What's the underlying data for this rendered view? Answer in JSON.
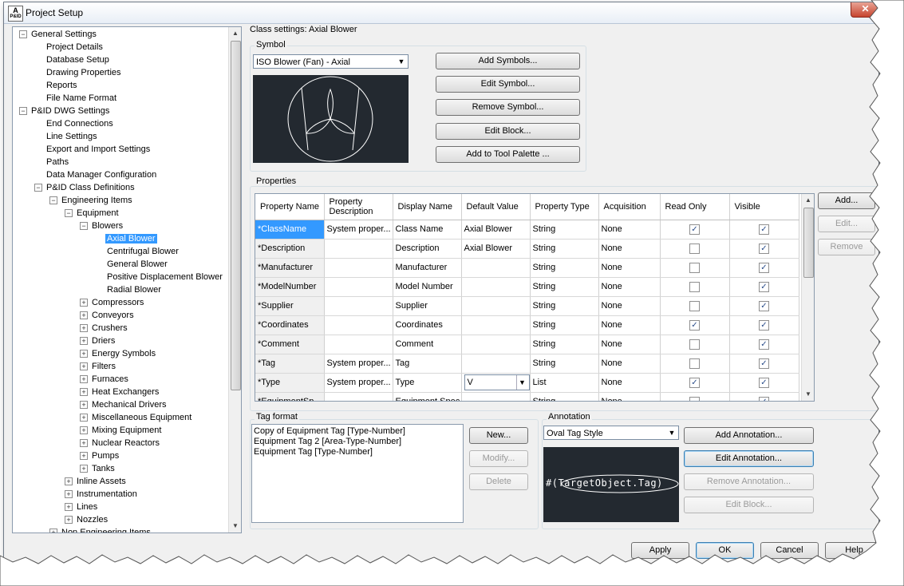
{
  "window": {
    "title": "Project Setup",
    "app_icon_text": "A",
    "app_icon_sub": "P&ID",
    "close_label": "✕"
  },
  "tree": {
    "nodes": [
      {
        "label": "General Settings",
        "level": 0,
        "expander": "−"
      },
      {
        "label": "Project Details",
        "level": 1
      },
      {
        "label": "Database Setup",
        "level": 1
      },
      {
        "label": "Drawing Properties",
        "level": 1
      },
      {
        "label": "Reports",
        "level": 1
      },
      {
        "label": "File Name Format",
        "level": 1
      },
      {
        "label": "P&ID DWG Settings",
        "level": 0,
        "expander": "−"
      },
      {
        "label": "End Connections",
        "level": 1
      },
      {
        "label": "Line Settings",
        "level": 1
      },
      {
        "label": "Export and Import Settings",
        "level": 1
      },
      {
        "label": "Paths",
        "level": 1
      },
      {
        "label": "Data Manager Configuration",
        "level": 1
      },
      {
        "label": "P&ID Class Definitions",
        "level": 1,
        "expander": "−"
      },
      {
        "label": "Engineering Items",
        "level": 2,
        "expander": "−"
      },
      {
        "label": "Equipment",
        "level": 3,
        "expander": "−"
      },
      {
        "label": "Blowers",
        "level": 4,
        "expander": "−"
      },
      {
        "label": "Axial Blower",
        "level": 5,
        "selected": true
      },
      {
        "label": "Centrifugal Blower",
        "level": 5
      },
      {
        "label": "General Blower",
        "level": 5
      },
      {
        "label": "Positive Displacement Blower",
        "level": 5
      },
      {
        "label": "Radial Blower",
        "level": 5
      },
      {
        "label": "Compressors",
        "level": 4,
        "expander": "+"
      },
      {
        "label": "Conveyors",
        "level": 4,
        "expander": "+"
      },
      {
        "label": "Crushers",
        "level": 4,
        "expander": "+"
      },
      {
        "label": "Driers",
        "level": 4,
        "expander": "+"
      },
      {
        "label": "Energy Symbols",
        "level": 4,
        "expander": "+"
      },
      {
        "label": "Filters",
        "level": 4,
        "expander": "+"
      },
      {
        "label": "Furnaces",
        "level": 4,
        "expander": "+"
      },
      {
        "label": "Heat Exchangers",
        "level": 4,
        "expander": "+"
      },
      {
        "label": "Mechanical Drivers",
        "level": 4,
        "expander": "+"
      },
      {
        "label": "Miscellaneous Equipment",
        "level": 4,
        "expander": "+"
      },
      {
        "label": "Mixing Equipment",
        "level": 4,
        "expander": "+"
      },
      {
        "label": "Nuclear Reactors",
        "level": 4,
        "expander": "+"
      },
      {
        "label": "Pumps",
        "level": 4,
        "expander": "+"
      },
      {
        "label": "Tanks",
        "level": 4,
        "expander": "+"
      },
      {
        "label": "Inline Assets",
        "level": 3,
        "expander": "+"
      },
      {
        "label": "Instrumentation",
        "level": 3,
        "expander": "+"
      },
      {
        "label": "Lines",
        "level": 3,
        "expander": "+"
      },
      {
        "label": "Nozzles",
        "level": 3,
        "expander": "+"
      },
      {
        "label": "Non Engineering Items",
        "level": 2,
        "expander": "+"
      }
    ]
  },
  "class_settings": {
    "heading": "Class settings: Axial Blower"
  },
  "symbol": {
    "group_label": "Symbol",
    "selected": "ISO Blower (Fan) - Axial",
    "buttons": [
      "Add Symbols...",
      "Edit Symbol...",
      "Remove Symbol...",
      "Edit Block...",
      "Add to Tool Palette ..."
    ]
  },
  "properties": {
    "group_label": "Properties",
    "columns": [
      "Property Name",
      "Property Description",
      "Display Name",
      "Default Value",
      "Property Type",
      "Acquisition",
      "Read Only",
      "Visible"
    ],
    "rows": [
      {
        "name": "*ClassName",
        "desc": "System proper...",
        "display": "Class Name",
        "default": "Axial Blower",
        "type": "String",
        "acq": "None",
        "readonly": true,
        "visible": true
      },
      {
        "name": "*Description",
        "desc": "",
        "display": "Description",
        "default": "Axial Blower",
        "type": "String",
        "acq": "None",
        "readonly": false,
        "visible": true
      },
      {
        "name": "*Manufacturer",
        "desc": "",
        "display": "Manufacturer",
        "default": "",
        "type": "String",
        "acq": "None",
        "readonly": false,
        "visible": true
      },
      {
        "name": "*ModelNumber",
        "desc": "",
        "display": "Model Number",
        "default": "",
        "type": "String",
        "acq": "None",
        "readonly": false,
        "visible": true
      },
      {
        "name": "*Supplier",
        "desc": "",
        "display": "Supplier",
        "default": "",
        "type": "String",
        "acq": "None",
        "readonly": false,
        "visible": true
      },
      {
        "name": "*Coordinates",
        "desc": "",
        "display": "Coordinates",
        "default": "",
        "type": "String",
        "acq": "None",
        "readonly": true,
        "visible": true
      },
      {
        "name": "*Comment",
        "desc": "",
        "display": "Comment",
        "default": "",
        "type": "String",
        "acq": "None",
        "readonly": false,
        "visible": true
      },
      {
        "name": "*Tag",
        "desc": "System proper...",
        "display": "Tag",
        "default": "",
        "type": "String",
        "acq": "None",
        "readonly": false,
        "visible": true
      },
      {
        "name": "*Type",
        "desc": "System proper...",
        "display": "Type",
        "default": "V",
        "type": "List",
        "acq": "None",
        "readonly": true,
        "visible": true,
        "default_combo": true
      },
      {
        "name": "*EquipmentSp...",
        "desc": "",
        "display": "Equipment Spec",
        "default": "",
        "type": "String",
        "acq": "None",
        "readonly": false,
        "visible": true
      }
    ],
    "buttons": [
      "Add...",
      "Edit...",
      "Remove"
    ]
  },
  "tag_format": {
    "group_label": "Tag format",
    "items": [
      "Copy of Equipment Tag [Type-Number]",
      "Equipment Tag 2 [Area-Type-Number]",
      "Equipment Tag [Type-Number]"
    ],
    "buttons": [
      "New...",
      "Modify...",
      "Delete"
    ]
  },
  "annotation": {
    "group_label": "Annotation",
    "selected": "Oval Tag Style",
    "preview_text": "#(TargetObject.Tag)",
    "buttons": [
      "Add Annotation...",
      "Edit Annotation...",
      "Remove Annotation...",
      "Edit Block..."
    ]
  },
  "footer": {
    "buttons": [
      "Apply",
      "OK",
      "Cancel",
      "Help"
    ]
  }
}
